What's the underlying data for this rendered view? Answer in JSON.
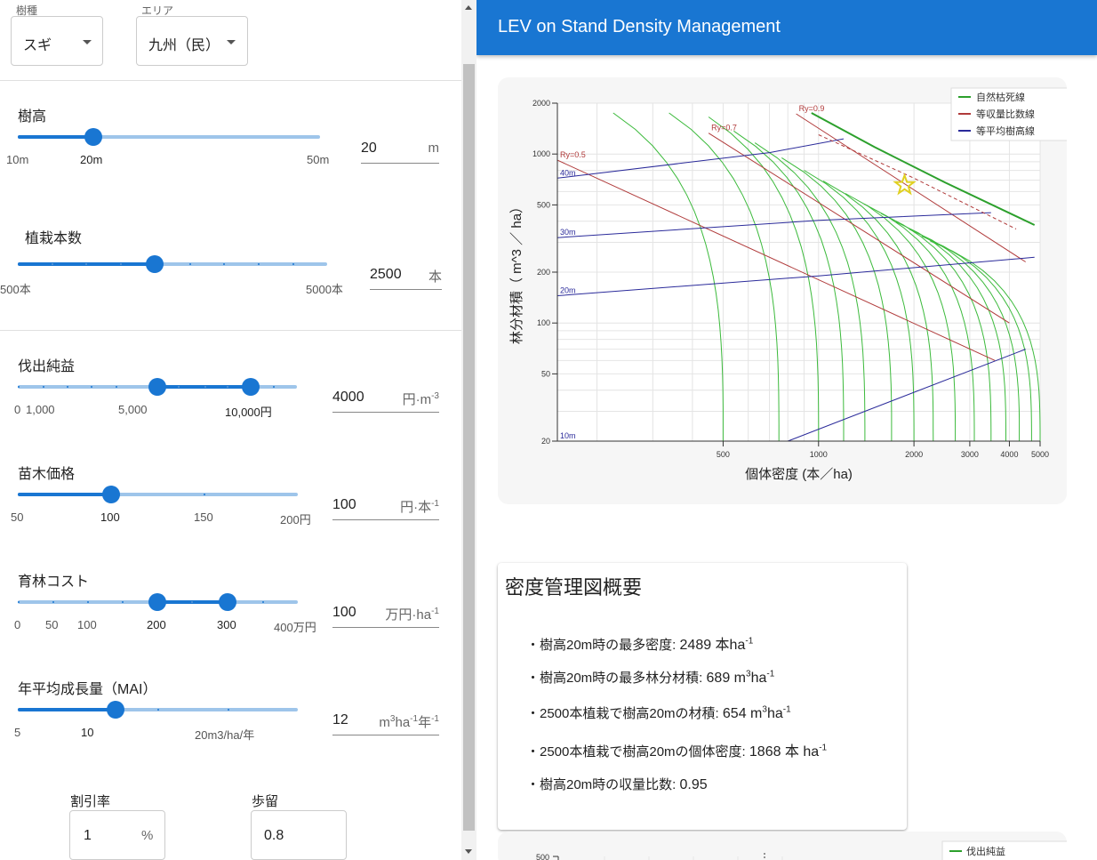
{
  "selectors": {
    "species": {
      "label": "樹種",
      "value": "スギ"
    },
    "area": {
      "label": "エリア",
      "value": "九州（民）"
    }
  },
  "sliders": {
    "height": {
      "label": "樹高",
      "value": "20",
      "unit": "m",
      "marks": [
        "10m",
        "20m",
        "50m"
      ]
    },
    "planting": {
      "label": "植栽本数",
      "value": "2500",
      "unit": "本",
      "marks": [
        "500本",
        "5000本"
      ]
    },
    "profit": {
      "label": "伐出純益",
      "value": "4000",
      "unit": "円·m",
      "unit_sup": "-3",
      "marks": [
        "0",
        "1,000",
        "5,000",
        "10,000円"
      ]
    },
    "seedling": {
      "label": "苗木価格",
      "value": "100",
      "unit": "円·本",
      "unit_sup": "-1",
      "marks": [
        "50",
        "100",
        "150",
        "200円"
      ]
    },
    "cost": {
      "label": "育林コスト",
      "value": "100",
      "unit": "万円·ha",
      "unit_sup": "-1",
      "marks": [
        "0",
        "50",
        "100",
        "200",
        "300",
        "400万円"
      ]
    },
    "mai": {
      "label": "年平均成長量（MAI）",
      "value": "12",
      "unit_a": "m",
      "unit_a_sup": "3",
      "unit_b": "ha",
      "unit_b_sup": "-1",
      "unit_c": "年",
      "unit_c_sup": "-1",
      "marks": [
        "5",
        "10",
        "20m3/ha/年"
      ]
    }
  },
  "discount": {
    "label": "割引率",
    "value": "1",
    "unit": "%"
  },
  "yield_rate": {
    "label": "歩留",
    "value": "0.8"
  },
  "appbar": {
    "title": "LEV on Stand Density Management"
  },
  "chart_data": [
    {
      "type": "line",
      "xlabel": "個体密度 (本／ha)",
      "ylabel": "林分材積（ m^3 ／ ha）",
      "x_scale": "log",
      "y_scale": "log",
      "xlim": [
        150,
        5000
      ],
      "ylim": [
        20,
        2000
      ],
      "xticks": [
        "500",
        "1000",
        "2000",
        "3000",
        "4000",
        "5000"
      ],
      "xtick_values": [
        500,
        1000,
        2000,
        3000,
        4000,
        5000
      ],
      "yticks": [
        "20",
        "50",
        "100",
        "200",
        "500",
        "1000",
        "2000"
      ],
      "ytick_values": [
        20,
        50,
        100,
        200,
        500,
        1000,
        2000
      ],
      "grid": true,
      "legend_position": "top-right",
      "legend": [
        {
          "name": "自然枯死線",
          "color": "#2ca02c"
        },
        {
          "name": "等収量比数線",
          "color": "#b03a3a"
        },
        {
          "name": "等平均樹高線",
          "color": "#2a2a9a"
        }
      ],
      "series": [
        {
          "name": "自然枯死線",
          "points": [
            [
              950,
              1750
            ],
            [
              1500,
              1100
            ],
            [
              2500,
              680
            ],
            [
              4800,
              380
            ]
          ]
        },
        {
          "name": "等収量比数線 Ry=0.5",
          "label": "Ry=0.5",
          "points": [
            [
              150,
              920
            ],
            [
              3600,
              60
            ]
          ]
        },
        {
          "name": "等収量比数線 Ry=0.7",
          "label": "Ry=0.7",
          "points": [
            [
              450,
              1330
            ],
            [
              4000,
              100
            ]
          ]
        },
        {
          "name": "等収量比数線 Ry=0.9",
          "label": "Ry=0.9",
          "points": [
            [
              850,
              1730
            ],
            [
              4500,
              230
            ]
          ]
        },
        {
          "name": "等平均樹高線 10m",
          "label": "10m",
          "points": [
            [
              150,
              20
            ],
            [
              800,
              20
            ],
            [
              4500,
              70
            ]
          ]
        },
        {
          "name": "等平均樹高線 20m",
          "label": "20m",
          "points": [
            [
              150,
              145
            ],
            [
              1000,
              190
            ],
            [
              4800,
              245
            ]
          ]
        },
        {
          "name": "等平均樹高線 30m",
          "label": "30m",
          "points": [
            [
              150,
              320
            ],
            [
              1000,
              405
            ],
            [
              3500,
              450
            ]
          ]
        },
        {
          "name": "等平均樹高線 40m",
          "label": "40m",
          "points": [
            [
              150,
              720
            ],
            [
              700,
              1020
            ],
            [
              1200,
              1230
            ]
          ]
        }
      ],
      "marker": {
        "label": "star",
        "x": 1868,
        "y": 654,
        "color": "#e0d020"
      }
    }
  ],
  "summary": {
    "title": "密度管理図概要",
    "items": [
      {
        "label": "・樹高20m時の最多密度: ",
        "value": "2489",
        "suffix": " 本ha",
        "sup": "-1"
      },
      {
        "label": "・樹高20m時の最多林分材積: ",
        "value": "689",
        "suffix": " m",
        "sup2": "3",
        "suffix2": "ha",
        "sup": "-1"
      },
      {
        "label": "・2500本植栽で樹高20mの材積: ",
        "value": "654",
        "suffix": " m",
        "sup2": "3",
        "suffix2": "ha",
        "sup": "-1"
      },
      {
        "label": "・2500本植栽で樹高20mの個体密度: ",
        "value": "1868",
        "suffix": " 本 ha",
        "sup": "-1"
      },
      {
        "label": "・樹高20m時の収量比数: ",
        "value": "0.95",
        "suffix": "",
        "sup": ""
      }
    ]
  },
  "second_chart": {
    "legend": "伐出純益",
    "ytick": "500"
  }
}
